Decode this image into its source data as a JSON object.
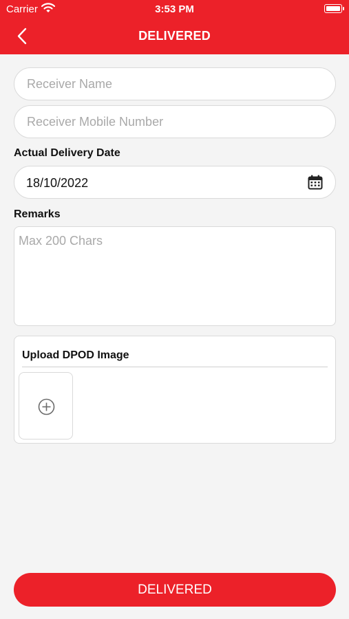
{
  "status_bar": {
    "carrier": "Carrier",
    "time": "3:53 PM"
  },
  "header": {
    "title": "DELIVERED",
    "back_icon": "chevron-left-icon"
  },
  "form": {
    "receiver_name": {
      "value": "",
      "placeholder": "Receiver Name"
    },
    "receiver_mobile": {
      "value": "",
      "placeholder": "Receiver Mobile Number"
    },
    "delivery_date": {
      "label": "Actual Delivery Date",
      "value": "18/10/2022",
      "icon": "calendar-icon"
    },
    "remarks": {
      "label": "Remarks",
      "value": "",
      "placeholder": "Max 200 Chars"
    },
    "upload": {
      "title": "Upload DPOD Image",
      "add_icon": "plus-circle-icon"
    }
  },
  "submit_button": {
    "label": "DELIVERED"
  },
  "colors": {
    "accent": "#ec2129",
    "background": "#f4f4f4",
    "field_border": "#d9d9d9",
    "placeholder": "#a9a9a9"
  }
}
